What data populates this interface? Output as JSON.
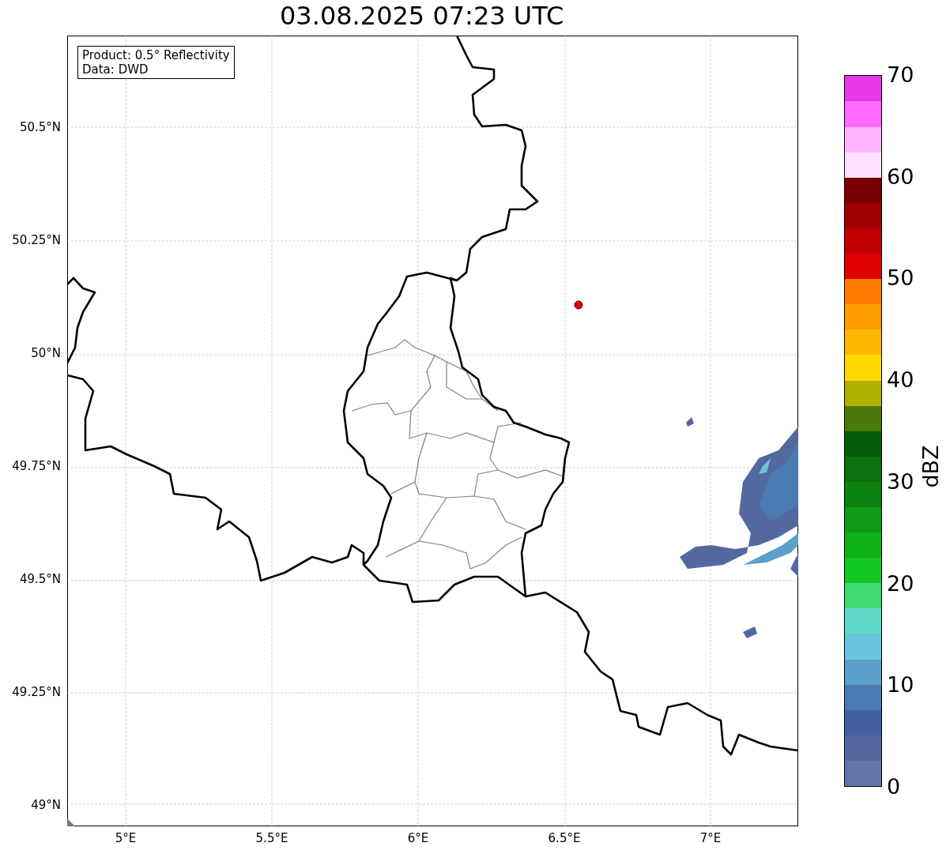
{
  "title": "03.08.2025 07:23 UTC",
  "info_box": {
    "lines": [
      "Product: 0.5° Reflectivity",
      "Data: DWD"
    ]
  },
  "map": {
    "y_ticks": [
      "50.5°N",
      "50.25°N",
      "50°N",
      "49.75°N",
      "49.5°N",
      "49.25°N",
      "49°N"
    ],
    "x_ticks": [
      "5°E",
      "5.5°E",
      "6°E",
      "6.5°E",
      "7°E"
    ]
  },
  "colorbar": {
    "label": "dBZ",
    "ticks": [
      "70",
      "60",
      "50",
      "40",
      "30",
      "20",
      "10",
      "0"
    ],
    "bins": [
      {
        "color": "#6474a8"
      },
      {
        "color": "#5468a0"
      },
      {
        "color": "#4460a0"
      },
      {
        "color": "#4a7ab0"
      },
      {
        "color": "#5aa0c8"
      },
      {
        "color": "#68c4dc"
      },
      {
        "color": "#60d8c8"
      },
      {
        "color": "#40d870"
      },
      {
        "color": "#10c820"
      },
      {
        "color": "#10b018"
      },
      {
        "color": "#109a18"
      },
      {
        "color": "#0c8010"
      },
      {
        "color": "#0a7010"
      },
      {
        "color": "#065a0a"
      },
      {
        "color": "#4a7a0a"
      },
      {
        "color": "#b0b000"
      },
      {
        "color": "#ffd800"
      },
      {
        "color": "#ffb800"
      },
      {
        "color": "#ff9c00"
      },
      {
        "color": "#ff7c00"
      },
      {
        "color": "#e00000"
      },
      {
        "color": "#c00000"
      },
      {
        "color": "#a00000"
      },
      {
        "color": "#780000"
      },
      {
        "color": "#ffe0ff"
      },
      {
        "color": "#ffb4ff"
      },
      {
        "color": "#ff6cff"
      },
      {
        "color": "#e838e8"
      }
    ]
  }
}
